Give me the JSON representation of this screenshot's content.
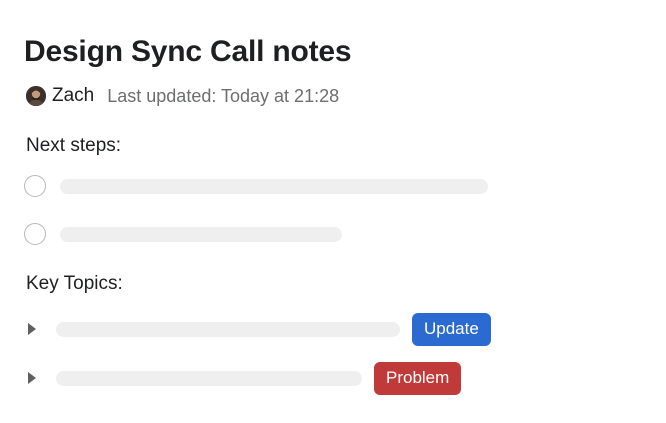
{
  "page": {
    "title": "Design Sync Call notes"
  },
  "meta": {
    "author": "Zach",
    "last_updated": "Last updated: Today at 21:28"
  },
  "next_steps": {
    "heading": "Next steps:",
    "tasks": [
      {
        "completed": false
      },
      {
        "completed": false
      }
    ]
  },
  "key_topics": {
    "heading": "Key Topics:",
    "items": [
      {
        "tag": "Update",
        "tag_color": "#2b6bd1"
      },
      {
        "tag": "Problem",
        "tag_color": "#c13a3a"
      }
    ]
  },
  "colors": {
    "placeholder": "#efefef",
    "muted_text": "#6d6e6f",
    "update_tag": "#2b6bd1",
    "problem_tag": "#c13a3a"
  }
}
